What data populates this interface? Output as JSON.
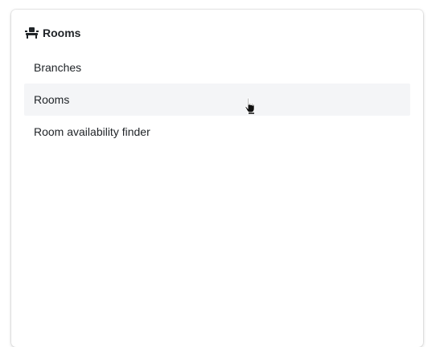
{
  "card": {
    "title": "Rooms",
    "title_icon": "couch-icon"
  },
  "menu": {
    "items": [
      {
        "label": "Branches",
        "hovered": false
      },
      {
        "label": "Rooms",
        "hovered": true
      },
      {
        "label": "Room availability finder",
        "hovered": false
      }
    ]
  },
  "colors": {
    "text": "#212529",
    "hover_bg": "#f4f5f7",
    "card_bg": "#ffffff"
  },
  "cursor": {
    "icon": "hand-pointer-icon"
  }
}
